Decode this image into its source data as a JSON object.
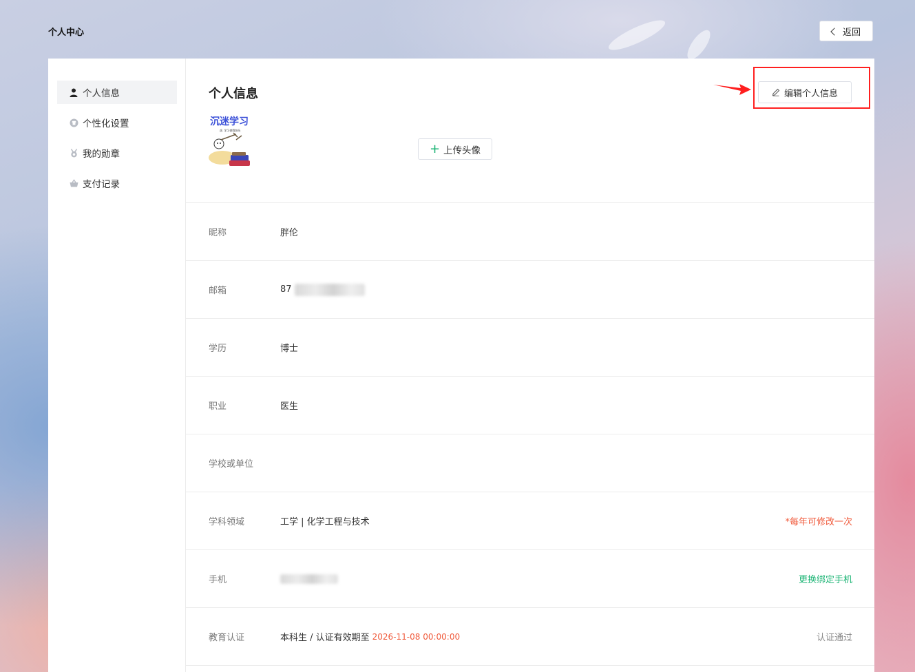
{
  "header": {
    "title": "个人中心",
    "back_label": "返回"
  },
  "sidebar": {
    "items": [
      {
        "label": "个人信息",
        "icon": "user-icon"
      },
      {
        "label": "个性化设置",
        "icon": "shirt-icon"
      },
      {
        "label": "我的勋章",
        "icon": "medal-icon"
      },
      {
        "label": "支付记录",
        "icon": "basket-icon"
      }
    ]
  },
  "main": {
    "title": "个人信息",
    "edit_label": "编辑个人信息",
    "upload_label": "上传头像",
    "avatar": {
      "title": "沉迷学习",
      "subtitle": "虎. 学习使我快乐",
      "title_color": "#3a4fd8"
    },
    "fields": [
      {
        "label": "昵称",
        "value": "胖伦"
      },
      {
        "label": "邮箱",
        "value": "87"
      },
      {
        "label": "学历",
        "value": "博士"
      },
      {
        "label": "职业",
        "value": "医生"
      },
      {
        "label": "学校或单位",
        "value": ""
      },
      {
        "label": "学科领域",
        "value": "工学 | 化学工程与技术",
        "note": "*每年可修改一次"
      },
      {
        "label": "手机",
        "value": "",
        "action": "更换绑定手机"
      },
      {
        "label": "教育认证",
        "value": "本科生 / 认证有效期至",
        "date": "2026-11-08 00:00:00",
        "status": "认证通过"
      }
    ]
  },
  "colors": {
    "accent_green": "#19b373",
    "note_red": "#f05a3b",
    "highlight_red": "#ff1f1f"
  }
}
